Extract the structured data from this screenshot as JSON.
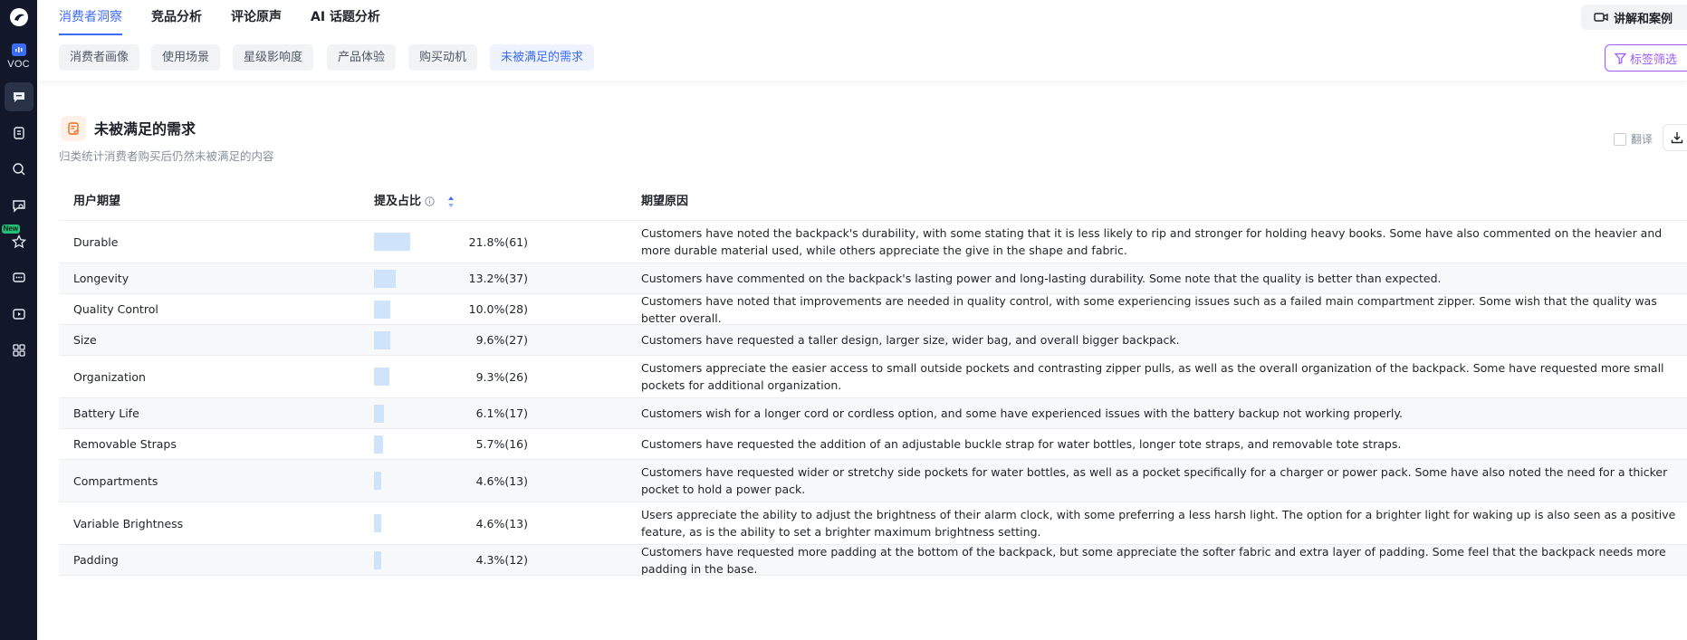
{
  "rail": {
    "voc_label": "VOC",
    "new_badge": "New"
  },
  "topnav": {
    "tabs": [
      {
        "label": "消费者洞察"
      },
      {
        "label": "竞品分析"
      },
      {
        "label": "评论原声"
      },
      {
        "label_prefix": "AI",
        "label": "话题分析"
      }
    ],
    "help_label": "讲解和案例"
  },
  "subnav": {
    "pills": [
      {
        "label": "消费者画像"
      },
      {
        "label": "使用场景"
      },
      {
        "label": "星级影响度"
      },
      {
        "label": "产品体验"
      },
      {
        "label": "购买动机"
      },
      {
        "label": "未被满足的需求"
      }
    ],
    "filter_label": "标签筛选"
  },
  "section": {
    "title": "未被满足的需求",
    "description": "归类统计消费者购买后仍然未被满足的内容",
    "translate_label": "翻译"
  },
  "table": {
    "headers": {
      "expectation": "用户期望",
      "share": "提及占比",
      "reason": "期望原因"
    },
    "rows": [
      {
        "name": "Durable",
        "pct": 21.8,
        "pct_text": "21.8%(61)",
        "reason": "Customers have noted the backpack's durability, with some stating that it is less likely to rip and stronger for holding heavy books. Some have also commented on the heavier and more durable material used, while others appreciate the give in the shape and fabric."
      },
      {
        "name": "Longevity",
        "pct": 13.2,
        "pct_text": "13.2%(37)",
        "reason": "Customers have commented on the backpack's lasting power and long-lasting durability. Some note that the quality is better than expected."
      },
      {
        "name": "Quality Control",
        "pct": 10.0,
        "pct_text": "10.0%(28)",
        "reason": "Customers have noted that improvements are needed in quality control, with some experiencing issues such as a failed main compartment zipper. Some wish that the quality was better overall."
      },
      {
        "name": "Size",
        "pct": 9.6,
        "pct_text": "9.6%(27)",
        "reason": "Customers have requested a taller design, larger size, wider bag, and overall bigger backpack."
      },
      {
        "name": "Organization",
        "pct": 9.3,
        "pct_text": "9.3%(26)",
        "reason": "Customers appreciate the easier access to small outside pockets and contrasting zipper pulls, as well as the overall organization of the backpack. Some have requested more small pockets for additional organization."
      },
      {
        "name": "Battery Life",
        "pct": 6.1,
        "pct_text": "6.1%(17)",
        "reason": "Customers wish for a longer cord or cordless option, and some have experienced issues with the battery backup not working properly."
      },
      {
        "name": "Removable Straps",
        "pct": 5.7,
        "pct_text": "5.7%(16)",
        "reason": "Customers have requested the addition of an adjustable buckle strap for water bottles, longer tote straps, and removable tote straps."
      },
      {
        "name": "Compartments",
        "pct": 4.6,
        "pct_text": "4.6%(13)",
        "reason": "Customers have requested wider or stretchy side pockets for water bottles, as well as a pocket specifically for a charger or power pack. Some have also noted the need for a thicker pocket to hold a power pack."
      },
      {
        "name": "Variable Brightness",
        "pct": 4.6,
        "pct_text": "4.6%(13)",
        "reason": "Users appreciate the ability to adjust the brightness of their alarm clock, with some preferring a less harsh light. The option for a brighter light for waking up is also seen as a positive feature, as is the ability to set a brighter maximum brightness setting."
      },
      {
        "name": "Padding",
        "pct": 4.3,
        "pct_text": "4.3%(12)",
        "reason": "Customers have requested more padding at the bottom of the backpack, but some appreciate the softer fabric and extra layer of padding. Some feel that the backpack needs more padding in the base."
      }
    ]
  },
  "colors": {
    "accent": "#3d6bf5",
    "filter": "#9b5cf6",
    "bar": "#cfe4fb",
    "rail": "#12182a"
  }
}
